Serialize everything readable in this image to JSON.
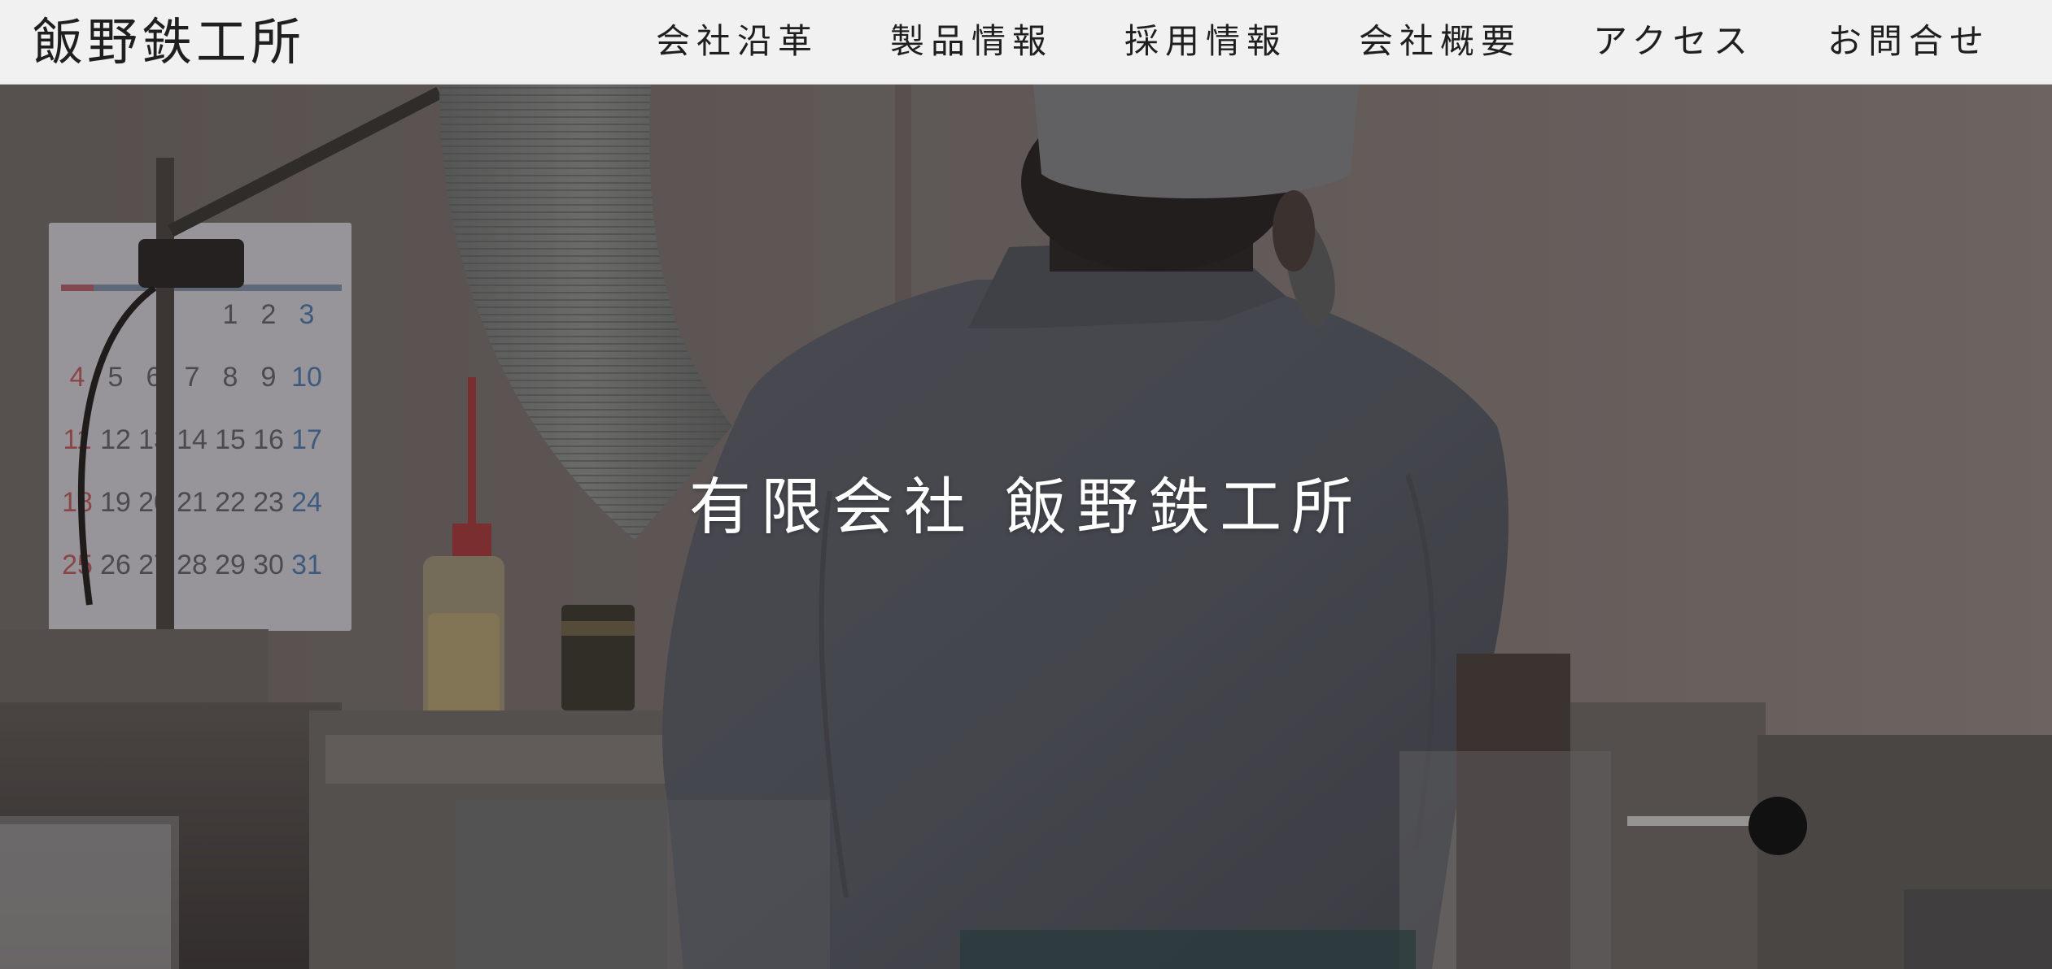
{
  "header": {
    "logo": "飯野鉄工所",
    "nav": [
      {
        "label": "会社沿革"
      },
      {
        "label": "製品情報"
      },
      {
        "label": "採用情報"
      },
      {
        "label": "会社概要"
      },
      {
        "label": "アクセス"
      },
      {
        "label": "お問合せ"
      }
    ]
  },
  "hero": {
    "title": "有限会社 飯野鉄工所",
    "calendar": {
      "rows": [
        [
          "",
          "",
          "",
          "1",
          "2",
          "3"
        ],
        [
          "4",
          "5",
          "6",
          "7",
          "8",
          "9",
          "10"
        ],
        [
          "11",
          "12",
          "13",
          "14",
          "15",
          "16",
          "17"
        ],
        [
          "18",
          "19",
          "20",
          "21",
          "22",
          "23",
          "24"
        ],
        [
          "25",
          "26",
          "27",
          "28",
          "29",
          "30",
          "31"
        ]
      ]
    }
  },
  "colors": {
    "header_bg": "#f1f1f1",
    "header_text": "#1f1f1f",
    "hero_text": "#ffffff",
    "wall": "#8a817d",
    "jacket": "#5b5f66"
  }
}
